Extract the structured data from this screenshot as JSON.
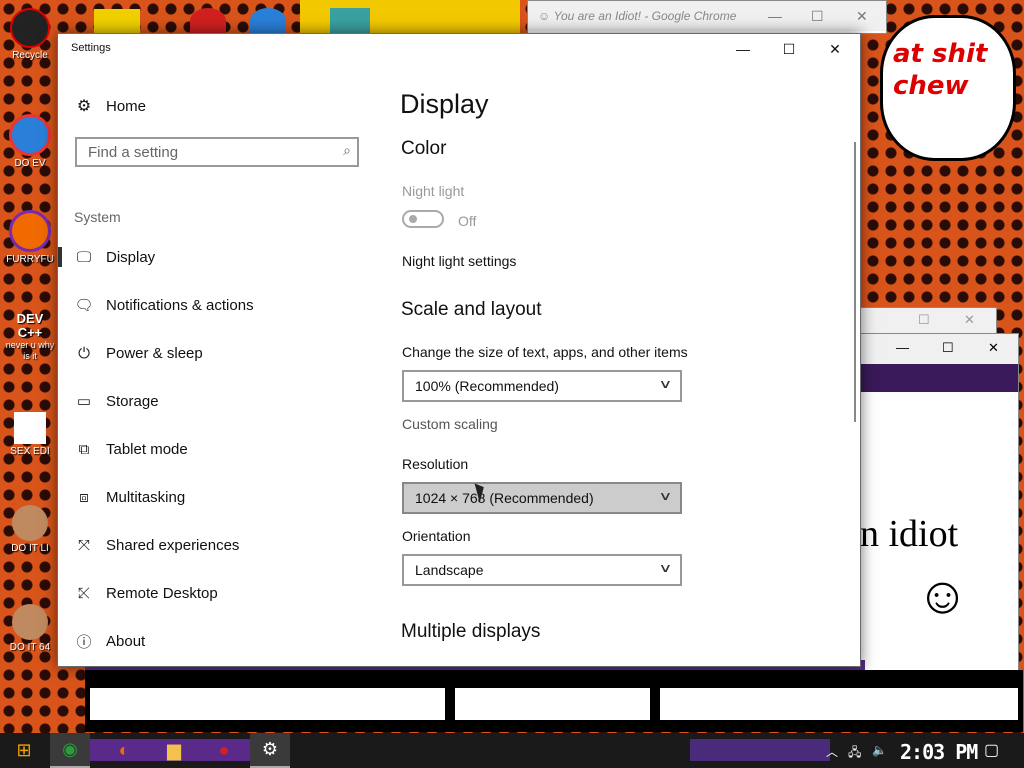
{
  "desktop": {
    "icons": [
      {
        "label": "Recycle",
        "color": "#d00000"
      },
      {
        "label": "DO EV",
        "color": "#2a7fd8"
      },
      {
        "label": "FURRYFU",
        "color": "#f06a00"
      },
      {
        "label": "DEV C++",
        "sublabel": "never u why is it",
        "color": "#c00000"
      },
      {
        "label": "SEX EDI",
        "color": "#2a8a2a"
      },
      {
        "label": "DO IT LI",
        "color": "#c08a60"
      },
      {
        "label": "DO IT 64",
        "color": "#c08a60"
      }
    ],
    "bubble_text": "at shit chew",
    "bg_text": "n idiot",
    "smiley": "☺"
  },
  "chrome_window": {
    "title": "You are an Idiot! - Google Chrome",
    "minimize": "—",
    "maximize": "☐",
    "close": "✕"
  },
  "settings": {
    "title": "Settings",
    "controls": {
      "minimize": "—",
      "maximize": "☐",
      "close": "✕"
    },
    "home_label": "Home",
    "search_placeholder": "Find a setting",
    "section_label": "System",
    "nav_items": [
      {
        "label": "Display",
        "icon": "monitor-icon",
        "glyph": "🖵",
        "active": true
      },
      {
        "label": "Notifications & actions",
        "icon": "notifications-icon",
        "glyph": "🗨",
        "active": false
      },
      {
        "label": "Power & sleep",
        "icon": "power-icon",
        "glyph": "⏻",
        "active": false
      },
      {
        "label": "Storage",
        "icon": "storage-icon",
        "glyph": "▭",
        "active": false
      },
      {
        "label": "Tablet mode",
        "icon": "tablet-icon",
        "glyph": "⧉",
        "active": false
      },
      {
        "label": "Multitasking",
        "icon": "multitasking-icon",
        "glyph": "⧈",
        "active": false
      },
      {
        "label": "Shared experiences",
        "icon": "shared-experiences-icon",
        "glyph": "⤧",
        "active": false
      },
      {
        "label": "Remote Desktop",
        "icon": "remote-desktop-icon",
        "glyph": "⤪",
        "active": false
      },
      {
        "label": "About",
        "icon": "about-icon",
        "glyph": "ⓘ",
        "active": false
      }
    ],
    "page_title": "Display",
    "color_heading": "Color",
    "night_light_label": "Night light",
    "night_light_state": "Off",
    "night_light_settings_link": "Night light settings",
    "scale_heading": "Scale and layout",
    "scale_label": "Change the size of text, apps, and other items",
    "scale_value": "100% (Recommended)",
    "custom_scaling_link": "Custom scaling",
    "resolution_label": "Resolution",
    "resolution_value": "1024 × 768 (Recommended)",
    "orientation_label": "Orientation",
    "orientation_value": "Landscape",
    "multiple_displays_heading": "Multiple displays"
  },
  "taskbar": {
    "start_glyph": "⊞",
    "apps": [
      {
        "name": "chrome",
        "glyph": "◉",
        "color": "#2a9d3a"
      },
      {
        "name": "firefox",
        "glyph": "◐",
        "color": "#f06a00"
      },
      {
        "name": "file-explorer",
        "glyph": "▆",
        "color": "#f2c14e"
      },
      {
        "name": "app-red",
        "glyph": "●",
        "color": "#d02020"
      },
      {
        "name": "settings",
        "glyph": "⚙",
        "color": "#ffffff"
      }
    ],
    "tray_up": "︿",
    "tray_network": "🖧",
    "tray_volume": "🔈",
    "clock": "2:03 PM",
    "notification": "▢"
  },
  "colors": {
    "desktop_orange": "#d9541a",
    "purple_accent": "#5a2a8a"
  }
}
